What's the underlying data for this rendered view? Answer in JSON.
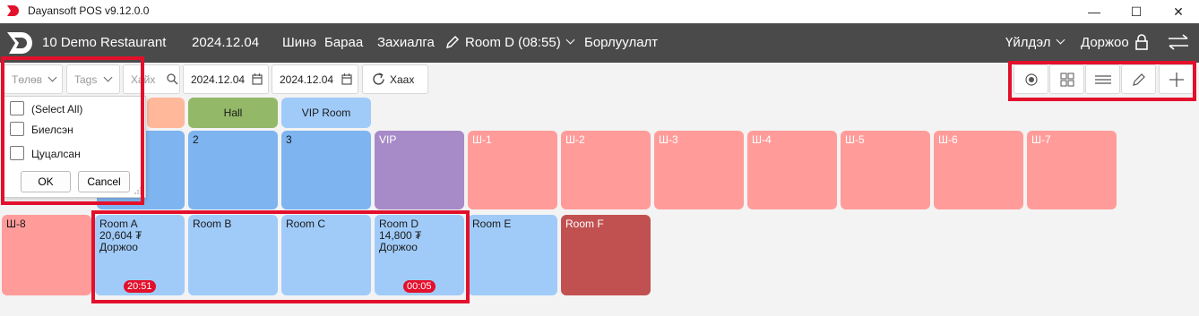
{
  "window": {
    "title": "Dayansoft POS v9.12.0.0",
    "minimize": "—",
    "maximize": "☐",
    "close": "✕"
  },
  "header": {
    "restaurant": "10 Demo Restaurant",
    "date": "2024.12.04",
    "nav": [
      "Шинэ",
      "Бараа",
      "Захиалга"
    ],
    "room_label": "Room D (08:55)",
    "sales": "Борлуулалт",
    "operations": "Үйлдэл",
    "user": "Доржоо"
  },
  "toolbar": {
    "status_placeholder": "Төлөв",
    "tags_placeholder": "Tags",
    "search_placeholder": "Хайх",
    "date_from": "2024.12.04",
    "date_to": "2024.12.04",
    "close_button": "Хаах"
  },
  "filter_popup": {
    "options": [
      "(Select All)",
      "Биелсэн",
      "Цуцалсан"
    ],
    "ok": "OK",
    "cancel": "Cancel"
  },
  "categories": [
    "Hall",
    "VIP Room"
  ],
  "tables_row1": [
    {
      "name": "2"
    },
    {
      "name": "3"
    },
    {
      "name": "VIP"
    },
    {
      "name": "Ш-1"
    },
    {
      "name": "Ш-2"
    },
    {
      "name": "Ш-3"
    },
    {
      "name": "Ш-4"
    },
    {
      "name": "Ш-5"
    },
    {
      "name": "Ш-6"
    },
    {
      "name": "Ш-7"
    }
  ],
  "tables_row2": [
    {
      "name": "Ш-8"
    },
    {
      "name": "Room A",
      "amount": "20,604 ₮",
      "waiter": "Доржоо",
      "timer": "20:51"
    },
    {
      "name": "Room B"
    },
    {
      "name": "Room C"
    },
    {
      "name": "Room D",
      "amount": "14,800 ₮",
      "waiter": "Доржоо",
      "timer": "00:05"
    },
    {
      "name": "Room E"
    },
    {
      "name": "Room F"
    }
  ],
  "colors": {
    "header_bg": "#4a4a4a",
    "tile_blue": "#7eb4ef",
    "tile_light_blue": "#a0cbf9",
    "tile_purple": "#a78ac8",
    "tile_pink": "#ff9c9a",
    "tile_dark_red": "#c15150",
    "hall_green": "#93b867",
    "highlight_red": "#e3102c"
  },
  "icons": [
    "app-logo-icon",
    "pencil-icon",
    "chevron-down-icon",
    "lock-icon",
    "swap-arrows-icon",
    "calendar-icon",
    "refresh-icon",
    "radio-icon",
    "grid-icon",
    "list-icon",
    "edit-icon",
    "plus-icon"
  ]
}
